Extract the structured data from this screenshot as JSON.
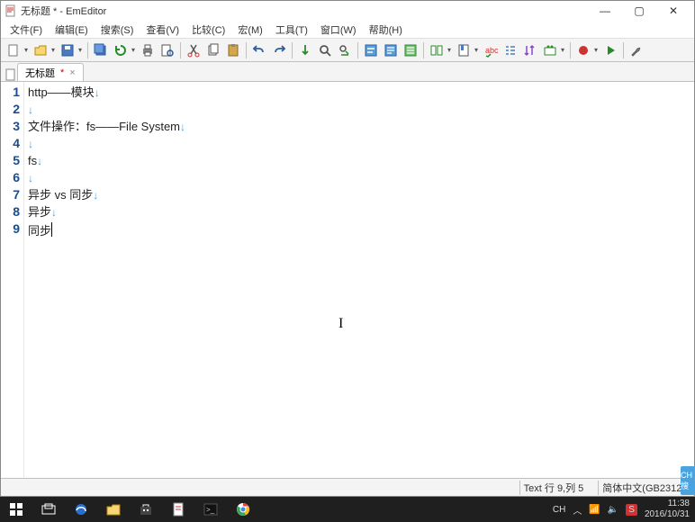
{
  "window": {
    "title": "无标题 * - EmEditor",
    "buttons": {
      "min": "—",
      "max": "▢",
      "close": "✕"
    }
  },
  "menu": {
    "items": [
      "文件(F)",
      "编辑(E)",
      "搜索(S)",
      "查看(V)",
      "比较(C)",
      "宏(M)",
      "工具(T)",
      "窗口(W)",
      "帮助(H)"
    ]
  },
  "tab": {
    "label": "无标题",
    "modified": "*",
    "close": "×"
  },
  "lines": [
    {
      "n": "1",
      "t": "http——模块"
    },
    {
      "n": "2",
      "t": ""
    },
    {
      "n": "3",
      "t": "文件操作：fs——File System"
    },
    {
      "n": "4",
      "t": ""
    },
    {
      "n": "5",
      "t": "fs"
    },
    {
      "n": "6",
      "t": ""
    },
    {
      "n": "7",
      "t": "异步 vs 同步"
    },
    {
      "n": "8",
      "t": "异步"
    },
    {
      "n": "9",
      "t": "同步"
    }
  ],
  "status": {
    "pos": "Text 行 9,列 5",
    "encoding": "简体中文(GB2312)"
  },
  "tray": {
    "ime": "CH",
    "up": "︿",
    "wifi": "📶",
    "sound": "🔈",
    "input": "S",
    "time": "11:38",
    "date": "2016/10/31"
  },
  "side_badge": "CH\n搜"
}
